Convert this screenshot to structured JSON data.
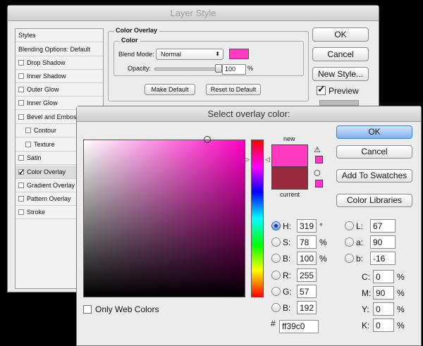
{
  "layer_style": {
    "title": "Layer Style",
    "styles_header": "Styles",
    "style_items": [
      {
        "label": "Blending Options: Default",
        "has_checkbox": false,
        "checked": false
      },
      {
        "label": "Drop Shadow",
        "has_checkbox": true,
        "checked": false
      },
      {
        "label": "Inner Shadow",
        "has_checkbox": true,
        "checked": false
      },
      {
        "label": "Outer Glow",
        "has_checkbox": true,
        "checked": false
      },
      {
        "label": "Inner Glow",
        "has_checkbox": true,
        "checked": false
      },
      {
        "label": "Bevel and Emboss",
        "has_checkbox": true,
        "checked": false
      },
      {
        "label": "Contour",
        "has_checkbox": true,
        "checked": false
      },
      {
        "label": "Texture",
        "has_checkbox": true,
        "checked": false
      },
      {
        "label": "Satin",
        "has_checkbox": true,
        "checked": false
      },
      {
        "label": "Color Overlay",
        "has_checkbox": true,
        "checked": true
      },
      {
        "label": "Gradient Overlay",
        "has_checkbox": true,
        "checked": false
      },
      {
        "label": "Pattern Overlay",
        "has_checkbox": true,
        "checked": false
      },
      {
        "label": "Stroke",
        "has_checkbox": true,
        "checked": false
      }
    ],
    "group_title": "Color Overlay",
    "subgroup_title": "Color",
    "blend_mode_label": "Blend Mode:",
    "blend_mode_value": "Normal",
    "overlay_color": "#ff39c0",
    "opacity_label": "Opacity:",
    "opacity_value": "100",
    "opacity_unit": "%",
    "make_default": "Make Default",
    "reset_default": "Reset to Default",
    "ok": "OK",
    "cancel": "Cancel",
    "new_style": "New Style...",
    "preview": "Preview",
    "preview_checked": true
  },
  "picker": {
    "title": "Select overlay color:",
    "new_label": "new",
    "current_label": "current",
    "new_color": "#ff39c0",
    "current_color": "#9a2a3b",
    "ok": "OK",
    "cancel": "Cancel",
    "add_swatches": "Add To Swatches",
    "color_libraries": "Color Libraries",
    "only_web_colors": "Only Web Colors",
    "hsb": [
      {
        "label": "H:",
        "value": "319",
        "unit": "°",
        "selected": true
      },
      {
        "label": "S:",
        "value": "78",
        "unit": "%",
        "selected": false
      },
      {
        "label": "B:",
        "value": "100",
        "unit": "%",
        "selected": false
      }
    ],
    "rgb": [
      {
        "label": "R:",
        "value": "255"
      },
      {
        "label": "G:",
        "value": "57"
      },
      {
        "label": "B:",
        "value": "192"
      }
    ],
    "lab": [
      {
        "label": "L:",
        "value": "67"
      },
      {
        "label": "a:",
        "value": "90"
      },
      {
        "label": "b:",
        "value": "-16"
      }
    ],
    "cmyk": [
      {
        "label": "C:",
        "value": "0",
        "unit": "%"
      },
      {
        "label": "M:",
        "value": "90",
        "unit": "%"
      },
      {
        "label": "Y:",
        "value": "0",
        "unit": "%"
      },
      {
        "label": "K:",
        "value": "0",
        "unit": "%"
      }
    ],
    "hex_label": "#",
    "hex_value": "ff39c0",
    "warning_swatch": "#ff39c0",
    "websafe_swatch": "#ff33cc"
  }
}
